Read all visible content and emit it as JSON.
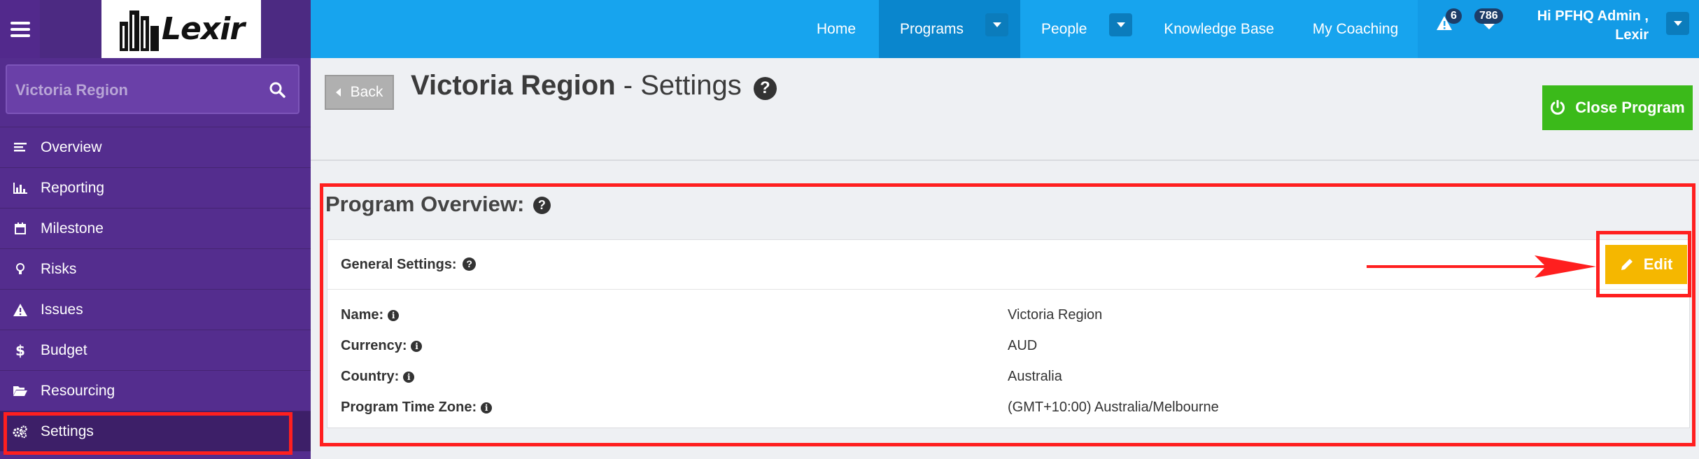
{
  "header": {
    "brand": "Lexir",
    "nav": [
      {
        "label": "Home"
      },
      {
        "label": "Programs"
      },
      {
        "label": "People"
      },
      {
        "label": "Knowledge Base"
      },
      {
        "label": "My Coaching"
      }
    ],
    "alerts_count": "6",
    "notifications_count": "786",
    "user_line1": "Hi PFHQ Admin ,",
    "user_line2": "Lexir"
  },
  "sidebar": {
    "search_value": "Victoria Region",
    "items": [
      {
        "label": "Overview",
        "icon": "list-icon"
      },
      {
        "label": "Reporting",
        "icon": "bar-chart-icon"
      },
      {
        "label": "Milestone",
        "icon": "calendar-icon"
      },
      {
        "label": "Risks",
        "icon": "lightbulb-icon"
      },
      {
        "label": "Issues",
        "icon": "warning-icon"
      },
      {
        "label": "Budget",
        "icon": "dollar-icon"
      },
      {
        "label": "Resourcing",
        "icon": "folder-open-icon"
      },
      {
        "label": "Settings",
        "icon": "cogs-icon"
      }
    ]
  },
  "main": {
    "back_label": "Back",
    "title_strong": "Victoria Region",
    "title_rest": " - Settings",
    "close_program_label": "Close Program",
    "overview_title": "Program Overview:",
    "general_settings_label": "General Settings:",
    "edit_label": "Edit",
    "rows": [
      {
        "label": "Name:",
        "value": "Victoria Region"
      },
      {
        "label": "Currency:",
        "value": "AUD"
      },
      {
        "label": "Country:",
        "value": "Australia"
      },
      {
        "label": "Program Time Zone:",
        "value": "(GMT+10:00) Australia/Melbourne"
      }
    ]
  },
  "colors": {
    "topbar": "#17a4ee",
    "sidebar": "#542d8e",
    "highlight": "#ff1f1f",
    "close_program": "#3bba1a",
    "edit": "#f5b700"
  }
}
